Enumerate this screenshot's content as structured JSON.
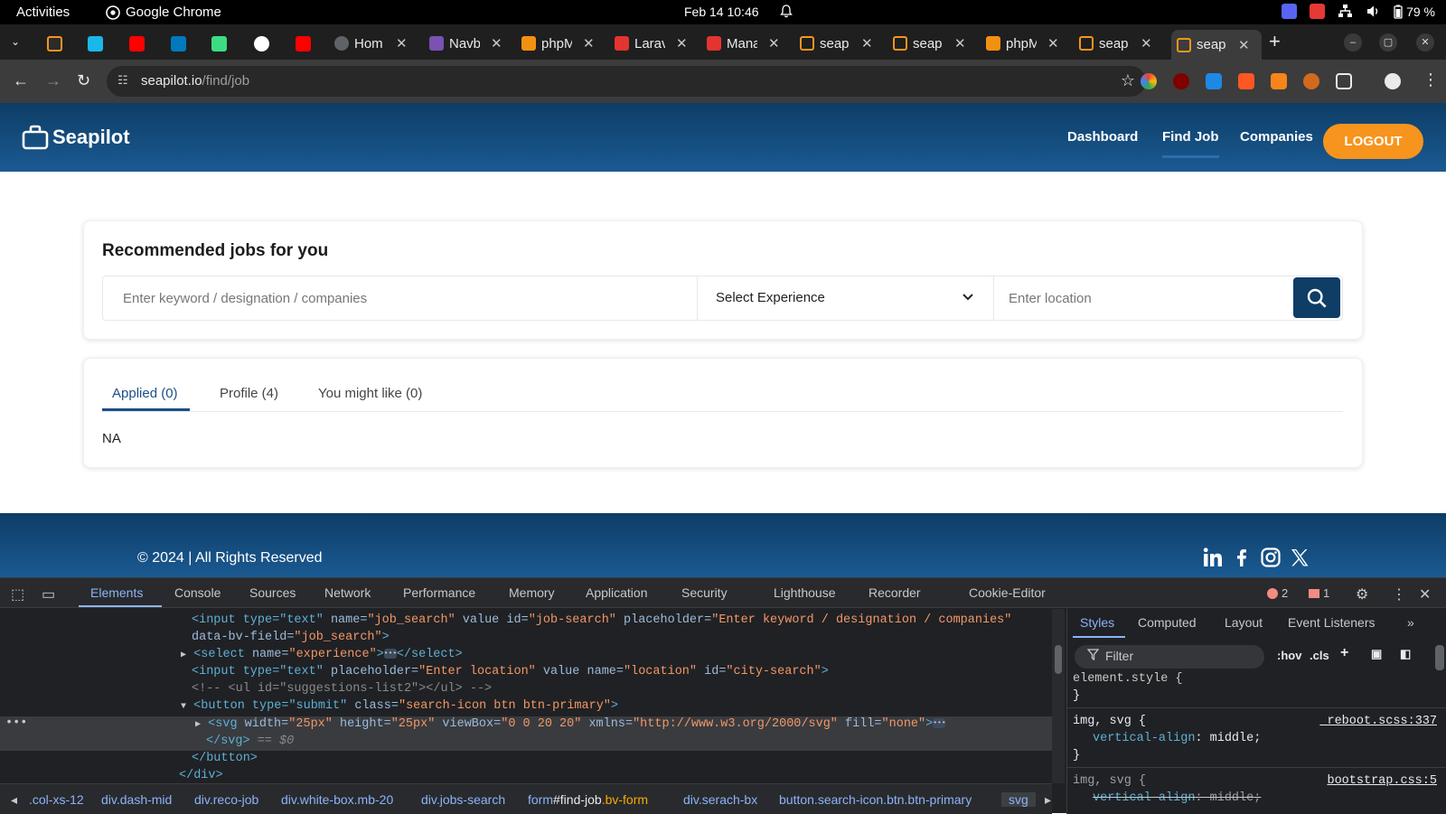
{
  "os_bar": {
    "activities": "Activities",
    "app_name": "Google Chrome",
    "clock": "Feb 14  10:46",
    "battery": "79 %"
  },
  "tabs": [
    {
      "label": "Hom",
      "color": "#5f6368"
    },
    {
      "label": "Navb",
      "color": "#7952b3"
    },
    {
      "label": "phpM",
      "color": "#f29111"
    },
    {
      "label": "Larav",
      "color": "#e3342f"
    },
    {
      "label": "Mana",
      "color": "#e3342f"
    },
    {
      "label": "seap",
      "color": "#f7941d"
    },
    {
      "label": "seap",
      "color": "#f7941d"
    },
    {
      "label": "phpM",
      "color": "#f29111"
    },
    {
      "label": "seap",
      "color": "#f7941d"
    },
    {
      "label": "seap",
      "color": "#f7941d"
    }
  ],
  "address": {
    "domain": "seapilot.io",
    "path": "/find/job"
  },
  "site": {
    "brand": "Seapilot",
    "nav": {
      "dashboard": "Dashboard",
      "find_job": "Find Job",
      "companies": "Companies",
      "logout": "LOGOUT"
    },
    "reco_title": "Recommended jobs for you",
    "search": {
      "keyword_placeholder": "Enter keyword / designation / companies",
      "experience_selected": "Select Experience",
      "location_placeholder": "Enter location"
    },
    "job_tabs": {
      "applied": "Applied (0)",
      "profile": "Profile (4)",
      "might_like": "You might like (0)"
    },
    "empty_text": "NA",
    "footer_copyright": "© 2024 | All Rights Reserved"
  },
  "devtools": {
    "tabs": {
      "elements": "Elements",
      "console": "Console",
      "sources": "Sources",
      "network": "Network",
      "performance": "Performance",
      "memory": "Memory",
      "application": "Application",
      "security": "Security",
      "lighthouse": "Lighthouse",
      "recorder": "Recorder",
      "cookie_editor": "Cookie-Editor"
    },
    "errors": "2",
    "issues": "1",
    "dom": {
      "l1_a": "<input type=\"text\" ",
      "l1_name_attr": "name=",
      "l1_name_val": "\"job_search\"",
      "l1_value_attr": " value id=",
      "l1_id_val": "\"job-search\"",
      "l1_ph_attr": " placeholder=",
      "l1_ph_val": "\"Enter keyword / designation / companies\"",
      "l2_attr": "data-bv-field=",
      "l2_val": "\"job_search\"",
      "l2_end": ">",
      "l3_open": "<select ",
      "l3_attr": "name=",
      "l3_val": "\"experience\"",
      "l3_close": "</select>",
      "l4_open": "<input type=\"text\" ",
      "l4_ph_attr": "placeholder=",
      "l4_ph_val": "\"Enter location\"",
      "l4_value_attr": " value name=",
      "l4_name_val": "\"location\"",
      "l4_id_attr": " id=",
      "l4_id_val": "\"city-search\"",
      "l4_end": ">",
      "l5_comment": "<!-- <ul id=\"suggestions-list2\"></ul> -->",
      "l6_open": "<button type=\"submit\" ",
      "l6_attr": "class=",
      "l6_val": "\"search-icon btn btn-primary\"",
      "l6_end": ">",
      "l7_open": "<svg ",
      "l7_w_attr": "width=",
      "l7_w_val": "\"25px\"",
      "l7_h_attr": " height=",
      "l7_h_val": "\"25px\"",
      "l7_vb_attr": " viewBox=",
      "l7_vb_val": "\"0 0 20 20\"",
      "l7_x_attr": " xmlns=",
      "l7_x_val": "\"http://www.w3.org/2000/svg\"",
      "l7_f_attr": " fill=",
      "l7_f_val": "\"none\"",
      "l7_end": ">",
      "l8_close": "</svg>",
      "l8_eq": " == $0",
      "l9_close": "</button>",
      "l10_close": "</div>"
    },
    "styles": {
      "tabs": {
        "styles": "Styles",
        "computed": "Computed",
        "layout": "Layout",
        "event_listeners": "Event Listeners"
      },
      "filter": "Filter",
      "hov": ":hov",
      "cls": ".cls",
      "rule1_selector": "element.style {",
      "brace_close": "}",
      "rule2_selector": "img, svg {",
      "rule2_prop": "vertical-align",
      "rule2_val": ": middle;",
      "rule2_src": "_reboot.scss:337",
      "rule3_selector": "img, svg {",
      "rule3_prop": "vertical-align",
      "rule3_val": ": middle;",
      "rule3_src": "bootstrap.css:5"
    },
    "breadcrumbs": {
      "c1": ".col-xs-12",
      "c2": "div.dash-mid",
      "c3": "div.reco-job",
      "c4": "div.white-box.mb-20",
      "c5": "div.jobs-search",
      "c6_tag": "form",
      "c6_id": "#find-job",
      "c6_cls": ".bv-form",
      "c7": "div.serach-bx",
      "c8": "button.search-icon.btn.btn-primary",
      "c9": "svg"
    }
  }
}
